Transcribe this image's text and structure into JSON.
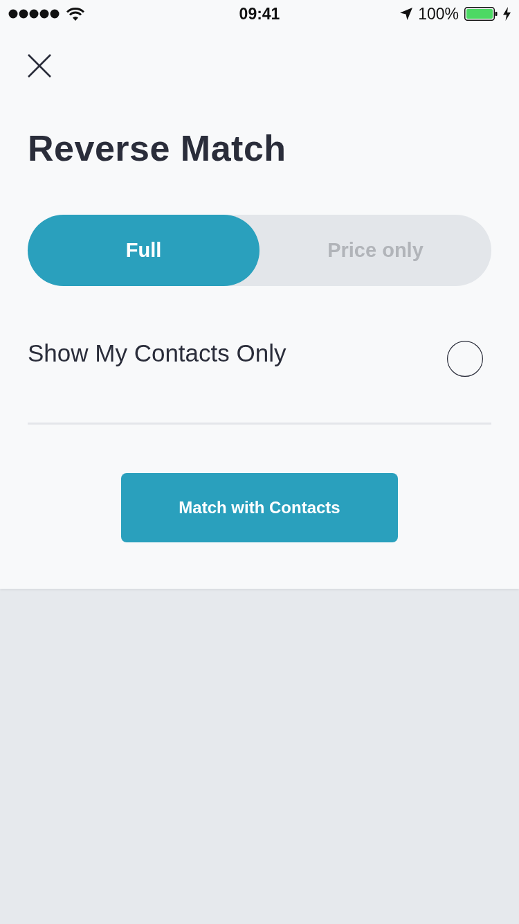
{
  "status_bar": {
    "time": "09:41",
    "battery_percent": "100%",
    "charging": true
  },
  "title": "Reverse Match",
  "segments": [
    {
      "label": "Full",
      "selected": true
    },
    {
      "label": "Price only",
      "selected": false
    }
  ],
  "option": {
    "label": "Show My Contacts Only",
    "checked": false
  },
  "button": {
    "label": "Match with Contacts"
  }
}
